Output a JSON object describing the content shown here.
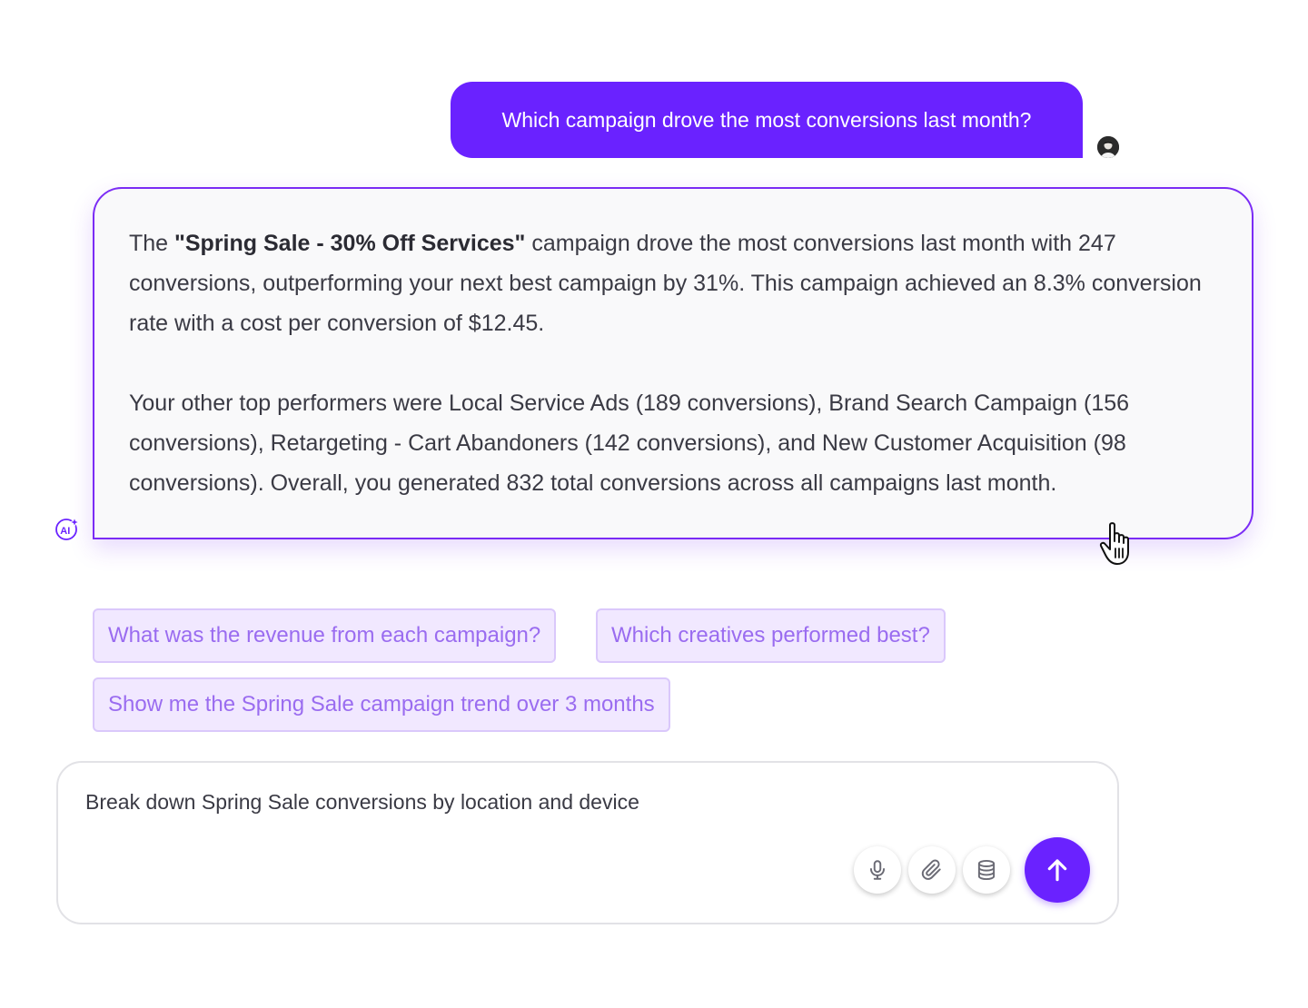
{
  "user_message": {
    "text": "Which campaign drove the most conversions last month?",
    "bubble_color": "#6a22ff"
  },
  "ai_response": {
    "p1_lead": "The ",
    "p1_bold": "\"Spring Sale - 30% Off Services\"",
    "p1_rest": " campaign drove the most conversions last month with 247 conversions, outperforming your next best campaign by 31%. This campaign achieved an 8.3% conversion rate with a cost per conversion of $12.45.",
    "p2": "Your other top performers were Local Service Ads (189 conversions), Brand Search Campaign (156 conversions), Retargeting - Cart Abandoners (142 conversions), and New Customer Acquisition (98 conversions). Overall, you generated 832 total conversions across all campaigns last month.",
    "border_color": "#7b2cf5",
    "icon": "ai-sparkle-icon"
  },
  "suggestions": {
    "items": [
      "What was the revenue from each campaign?",
      "Which creatives performed best?",
      "Show me the Spring Sale campaign trend over 3 months"
    ]
  },
  "composer": {
    "value": "Break down Spring Sale conversions by location and device",
    "icons": [
      "microphone-icon",
      "paperclip-icon",
      "database-icon",
      "arrow-up-icon"
    ],
    "send_color": "#6a22ff"
  }
}
